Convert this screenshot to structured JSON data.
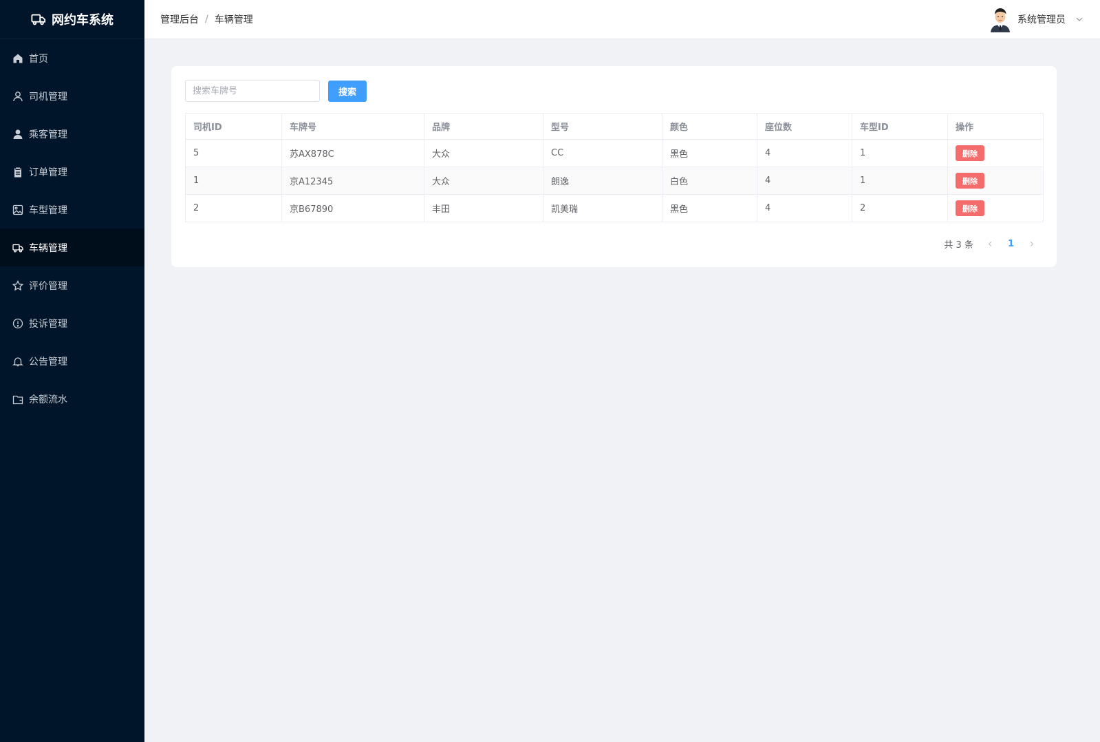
{
  "app": {
    "title": "网约车系统"
  },
  "sidebar": {
    "items": [
      {
        "label": "首页",
        "icon": "home-icon"
      },
      {
        "label": "司机管理",
        "icon": "user-outline-icon"
      },
      {
        "label": "乘客管理",
        "icon": "user-solid-icon"
      },
      {
        "label": "订单管理",
        "icon": "clipboard-icon"
      },
      {
        "label": "车型管理",
        "icon": "picture-icon"
      },
      {
        "label": "车辆管理",
        "icon": "truck-icon",
        "active": true
      },
      {
        "label": "评价管理",
        "icon": "star-icon"
      },
      {
        "label": "投诉管理",
        "icon": "warning-icon"
      },
      {
        "label": "公告管理",
        "icon": "bell-icon"
      },
      {
        "label": "余额流水",
        "icon": "wallet-icon"
      }
    ]
  },
  "header": {
    "breadcrumb": [
      "管理后台",
      "车辆管理"
    ],
    "breadcrumb_sep": "/",
    "user_name": "系统管理员"
  },
  "search": {
    "placeholder": "搜索车牌号",
    "value": "",
    "button_label": "搜索"
  },
  "table": {
    "columns": [
      "司机ID",
      "车牌号",
      "品牌",
      "型号",
      "颜色",
      "座位数",
      "车型ID",
      "操作"
    ],
    "rows": [
      {
        "driver_id": "5",
        "plate": "苏AX878C",
        "brand": "大众",
        "model": "CC",
        "color": "黑色",
        "seats": "4",
        "type_id": "1",
        "action": "删除"
      },
      {
        "driver_id": "1",
        "plate": "京A12345",
        "brand": "大众",
        "model": "朗逸",
        "color": "白色",
        "seats": "4",
        "type_id": "1",
        "action": "删除"
      },
      {
        "driver_id": "2",
        "plate": "京B67890",
        "brand": "丰田",
        "model": "凯美瑞",
        "color": "黑色",
        "seats": "4",
        "type_id": "2",
        "action": "删除"
      }
    ]
  },
  "pagination": {
    "total_text": "共 3 条",
    "current_page": "1"
  },
  "colors": {
    "sidebar_bg": "#001529",
    "primary": "#409eff",
    "danger": "#f56c6c",
    "page_bg": "#f0f2f5"
  }
}
